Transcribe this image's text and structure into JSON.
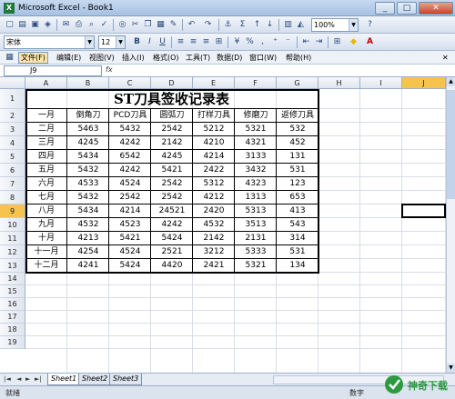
{
  "window": {
    "title": "Microsoft Excel - Book1",
    "min": "_",
    "max": "□",
    "close": "✕"
  },
  "formatting": {
    "font": "宋体",
    "size": "12",
    "zoom": "100%"
  },
  "menubar": {
    "items": [
      "文件(F)",
      "编辑(E)",
      "视图(V)",
      "插入(I)",
      "格式(O)",
      "工具(T)",
      "数据(D)",
      "窗口(W)",
      "帮助(H)"
    ]
  },
  "formula_bar": {
    "name_box": "J9",
    "fx": "fx",
    "content": ""
  },
  "columns": [
    "A",
    "B",
    "C",
    "D",
    "E",
    "F",
    "G",
    "H",
    "I",
    "J"
  ],
  "rows": [
    "1",
    "2",
    "3",
    "4",
    "5",
    "6",
    "7",
    "8",
    "9",
    "10",
    "11",
    "12",
    "13",
    "14",
    "15",
    "16",
    "17",
    "18",
    "19"
  ],
  "active_cell": {
    "column": "J",
    "row": "9"
  },
  "sheet": {
    "title": "ST刀具签收记录表",
    "headers": [
      "一月",
      "倒角刀",
      "PCD刀具",
      "圆弧刀",
      "打样刀具",
      "修磨刀",
      "返修刀具"
    ],
    "rows": [
      [
        "二月",
        "5463",
        "5432",
        "2542",
        "5212",
        "5321",
        "532"
      ],
      [
        "三月",
        "4245",
        "4242",
        "2142",
        "4210",
        "4321",
        "452"
      ],
      [
        "四月",
        "5434",
        "6542",
        "4245",
        "4214",
        "3133",
        "131"
      ],
      [
        "五月",
        "5432",
        "4242",
        "5421",
        "2422",
        "3432",
        "531"
      ],
      [
        "六月",
        "4533",
        "4524",
        "2542",
        "5312",
        "4323",
        "123"
      ],
      [
        "七月",
        "5432",
        "2542",
        "2542",
        "4212",
        "1313",
        "653"
      ],
      [
        "八月",
        "5434",
        "4214",
        "24521",
        "2420",
        "5313",
        "413"
      ],
      [
        "九月",
        "4532",
        "4523",
        "4242",
        "4532",
        "3513",
        "543"
      ],
      [
        "十月",
        "4213",
        "5421",
        "5424",
        "2142",
        "2131",
        "314"
      ],
      [
        "十一月",
        "4254",
        "4524",
        "2521",
        "3212",
        "5333",
        "531"
      ],
      [
        "十二月",
        "4241",
        "5424",
        "4420",
        "2421",
        "5321",
        "134"
      ]
    ]
  },
  "tabs": {
    "nav": [
      "|◄",
      "◄",
      "►",
      "►|"
    ],
    "sheets": [
      "Sheet1",
      "Sheet2",
      "Sheet3"
    ]
  },
  "status": {
    "left": "就绪",
    "right": "数字"
  },
  "watermark": {
    "text": "神奇下载"
  },
  "colors": {
    "title_bar": "#a6c1e3",
    "active_header": "#f6c44d",
    "grid_line": "#d8dde6"
  }
}
